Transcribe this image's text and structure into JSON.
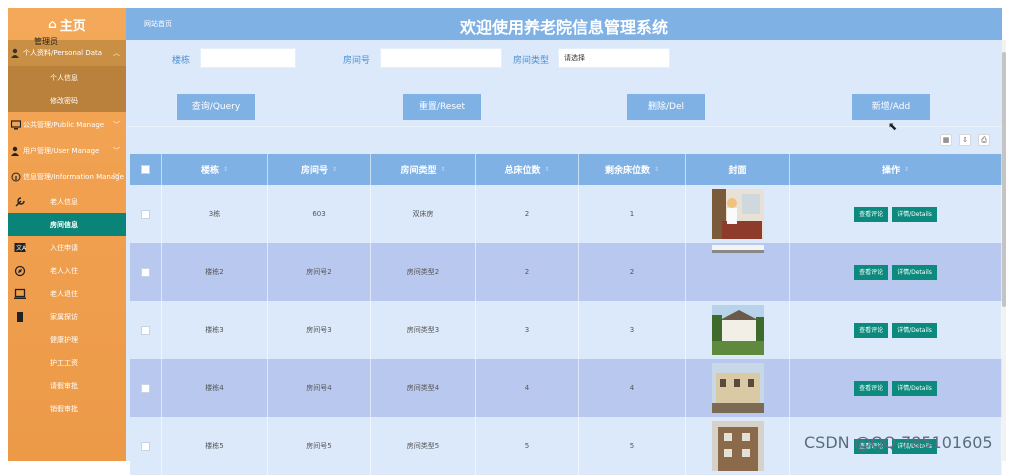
{
  "sidebar": {
    "home": "主页",
    "tooltip": "管理员",
    "groups": [
      {
        "label": "个人资料/Personal Data",
        "open": true,
        "sub": [
          "个人信息",
          "修改密码"
        ]
      },
      {
        "label": "公共管理/Public Manage"
      },
      {
        "label": "用户管理/User Manage"
      },
      {
        "label": "信息管理/Information Manage"
      }
    ],
    "info_items": [
      "老人信息",
      "房间信息",
      "入住申请",
      "老人入住",
      "老人退住",
      "家属探访",
      "健康护理",
      "护工工资",
      "请假审批",
      "销假审批"
    ],
    "selected": "房间信息"
  },
  "topbar": {
    "crumb": "网站首页",
    "title": "欢迎使用养老院信息管理系统"
  },
  "search": {
    "building_label": "楼栋",
    "building_value": "",
    "room_label": "房间号",
    "room_value": "",
    "type_label": "房间类型",
    "type_placeholder": "请选择"
  },
  "buttons": {
    "query": "查询/Query",
    "reset": "重置/Reset",
    "delete": "删除/Del",
    "add": "新增/Add"
  },
  "table": {
    "headers": [
      "楼栋",
      "房间号",
      "房间类型",
      "总床位数",
      "剩余床位数",
      "封面",
      "操作"
    ],
    "rows": [
      {
        "building": "3栋",
        "room": "603",
        "type": "双床房",
        "total": "2",
        "remain": "1"
      },
      {
        "building": "楼栋2",
        "room": "房间号2",
        "type": "房间类型2",
        "total": "2",
        "remain": "2"
      },
      {
        "building": "楼栋3",
        "room": "房间号3",
        "type": "房间类型3",
        "total": "3",
        "remain": "3"
      },
      {
        "building": "楼栋4",
        "room": "房间号4",
        "type": "房间类型4",
        "total": "4",
        "remain": "4"
      },
      {
        "building": "楼栋5",
        "room": "房间号5",
        "type": "房间类型5",
        "total": "5",
        "remain": "5"
      }
    ],
    "action_review": "查看评论",
    "action_details": "详情/Details"
  },
  "watermark": "CSDN @QQ 785101605",
  "colors": {
    "accent": "#7fb1e5",
    "sidebar": "#f0a04f",
    "selected": "#0a8378",
    "action": "#0c8a7e"
  }
}
